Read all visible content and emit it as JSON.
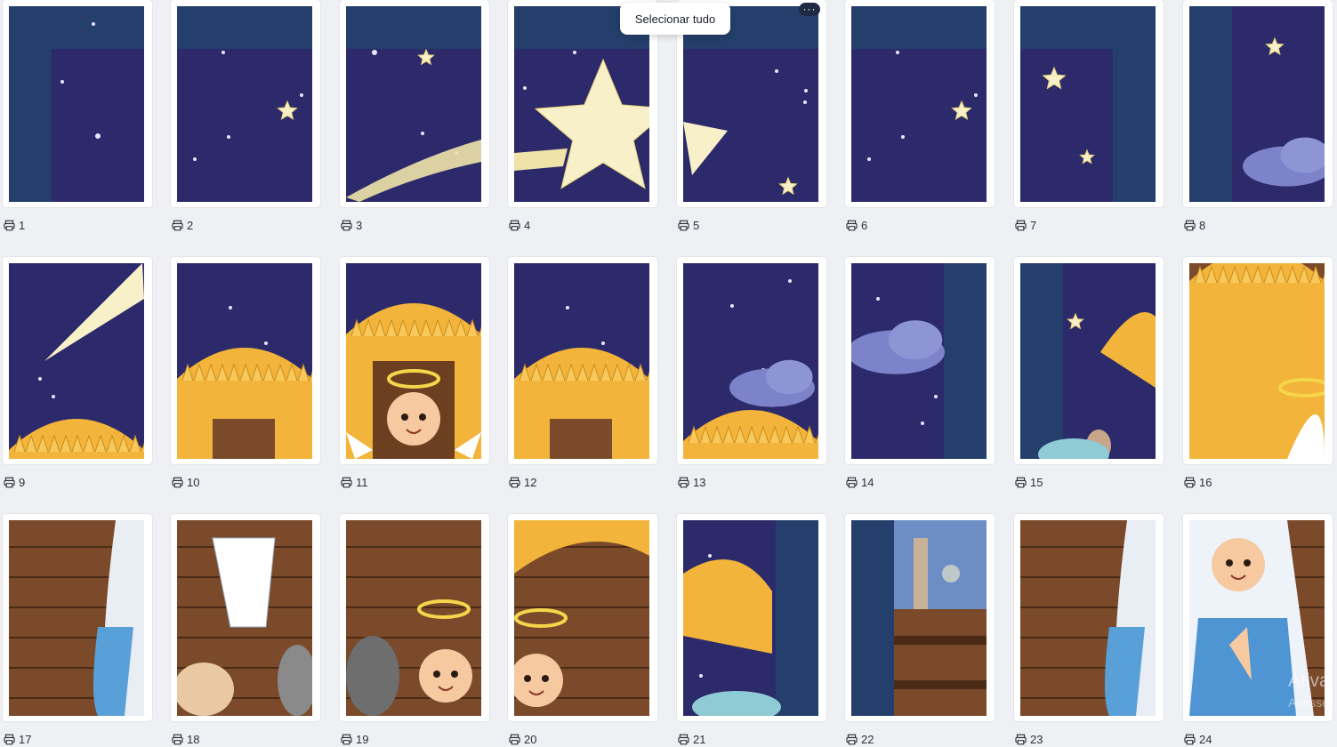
{
  "toolbar": {
    "tooltip": "Selecionar tudo",
    "more_label": "···"
  },
  "pages": [
    {
      "number": "1",
      "icon": "print-icon",
      "scene": "sky-corner"
    },
    {
      "number": "2",
      "icon": "print-icon",
      "scene": "sky-top"
    },
    {
      "number": "3",
      "icon": "print-icon",
      "scene": "comet-tail"
    },
    {
      "number": "4",
      "icon": "print-icon",
      "scene": "big-star"
    },
    {
      "number": "5",
      "icon": "print-icon",
      "scene": "star-tip"
    },
    {
      "number": "6",
      "icon": "print-icon",
      "scene": "sky-top"
    },
    {
      "number": "7",
      "icon": "print-icon",
      "scene": "sky-right"
    },
    {
      "number": "8",
      "icon": "print-icon",
      "scene": "cloud-right"
    },
    {
      "number": "9",
      "icon": "print-icon",
      "scene": "comet-roof"
    },
    {
      "number": "10",
      "icon": "print-icon",
      "scene": "roof"
    },
    {
      "number": "11",
      "icon": "print-icon",
      "scene": "angel-roof"
    },
    {
      "number": "12",
      "icon": "print-icon",
      "scene": "roof"
    },
    {
      "number": "13",
      "icon": "print-icon",
      "scene": "cloud-roof"
    },
    {
      "number": "14",
      "icon": "print-icon",
      "scene": "cloud-band"
    },
    {
      "number": "15",
      "icon": "print-icon",
      "scene": "dome-roof"
    },
    {
      "number": "16",
      "icon": "print-icon",
      "scene": "stable-halo"
    },
    {
      "number": "17",
      "icon": "print-icon",
      "scene": "stable-wood"
    },
    {
      "number": "18",
      "icon": "print-icon",
      "scene": "angel-stable"
    },
    {
      "number": "19",
      "icon": "print-icon",
      "scene": "donkey-joseph"
    },
    {
      "number": "20",
      "icon": "print-icon",
      "scene": "stable-roof"
    },
    {
      "number": "21",
      "icon": "print-icon",
      "scene": "roof-band"
    },
    {
      "number": "22",
      "icon": "print-icon",
      "scene": "town-band"
    },
    {
      "number": "23",
      "icon": "print-icon",
      "scene": "stable-wood"
    },
    {
      "number": "24",
      "icon": "print-icon",
      "scene": "mary"
    }
  ],
  "watermark": {
    "line1": "Ativa",
    "line2": "Acesse"
  },
  "colors": {
    "sky": "#2c2a6b",
    "margin_band": "#243f6b",
    "straw": "#f2b43a",
    "wood": "#7a4a2a",
    "star": "#f7f0c8"
  }
}
